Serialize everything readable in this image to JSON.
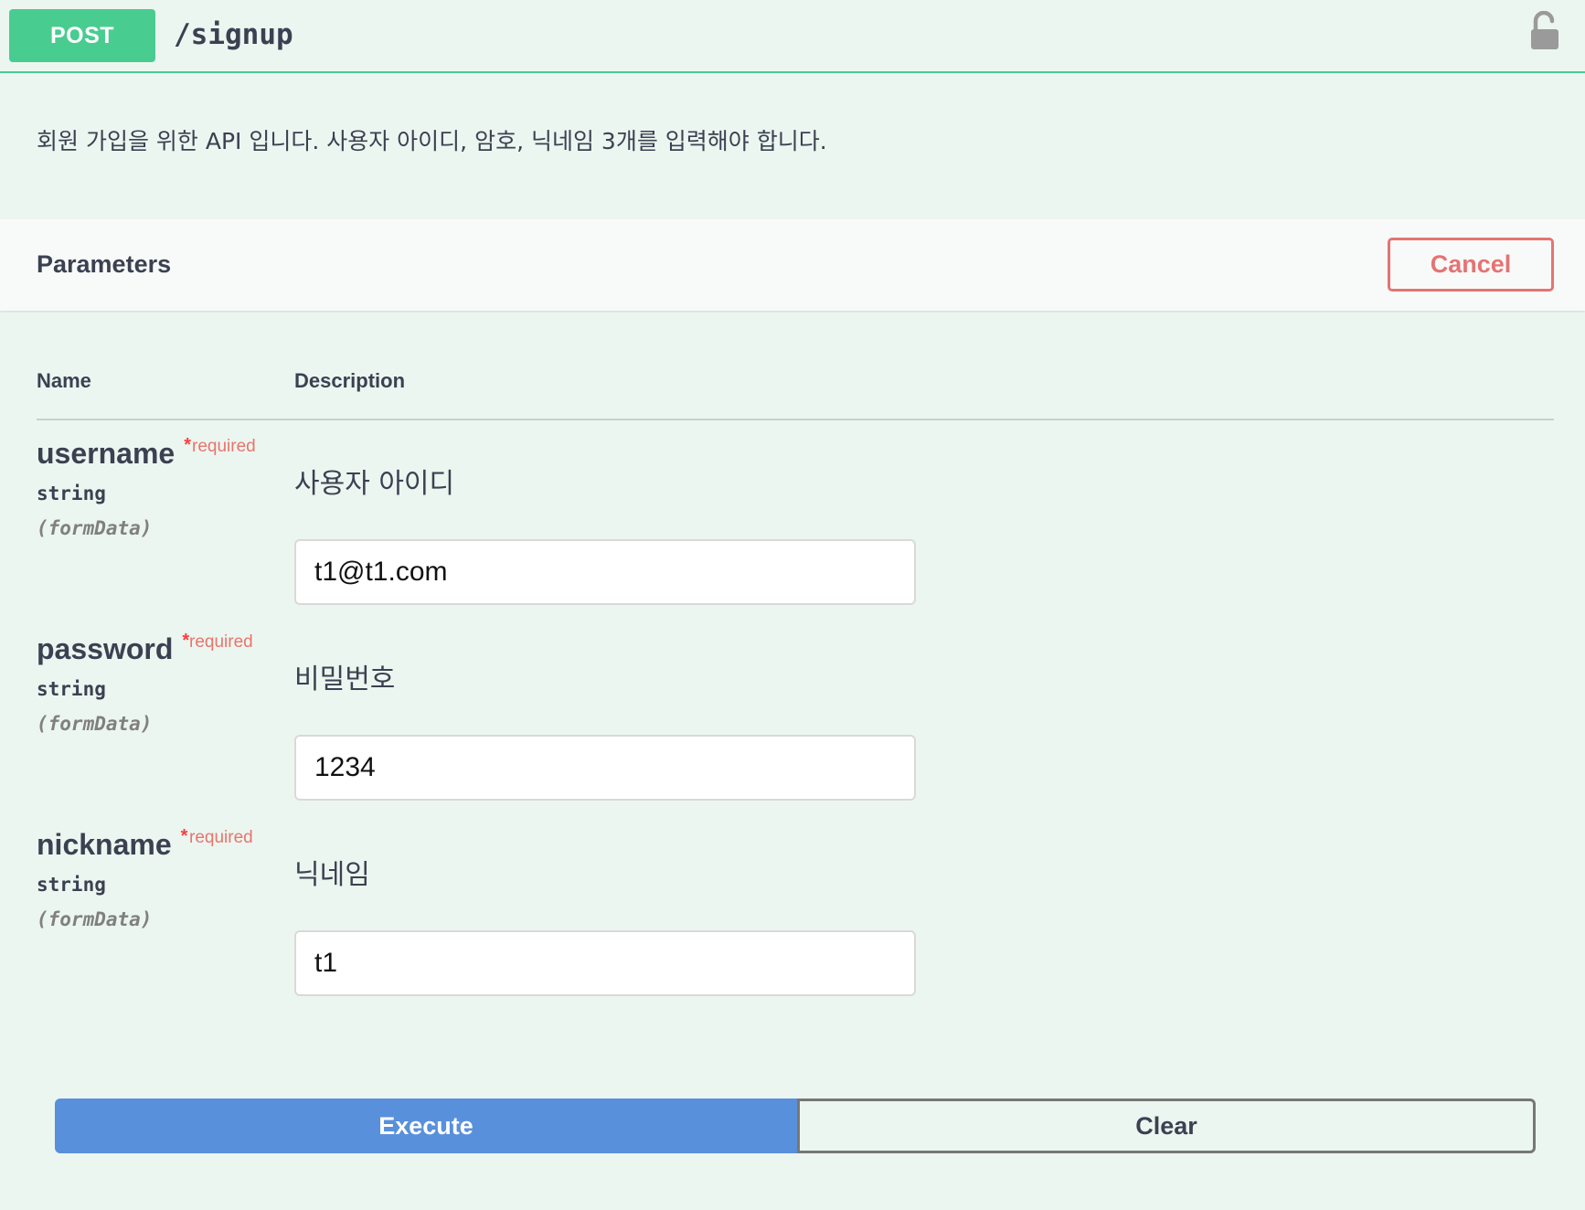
{
  "operation": {
    "method": "POST",
    "path": "/signup",
    "lock_icon": "unlocked-padlock",
    "description": "회원 가입을 위한 API 입니다. 사용자 아이디, 암호, 닉네임 3개를 입력해야 합니다."
  },
  "parameters": {
    "title": "Parameters",
    "cancel_label": "Cancel",
    "columns": {
      "name": "Name",
      "description": "Description"
    },
    "items": [
      {
        "name": "username",
        "required_mark": "*",
        "required_label": "required",
        "type": "string",
        "in": "(formData)",
        "description": "사용자 아이디",
        "value": "t1@t1.com"
      },
      {
        "name": "password",
        "required_mark": "*",
        "required_label": "required",
        "type": "string",
        "in": "(formData)",
        "description": "비밀번호",
        "value": "1234"
      },
      {
        "name": "nickname",
        "required_mark": "*",
        "required_label": "required",
        "type": "string",
        "in": "(formData)",
        "description": "닉네임",
        "value": "t1"
      }
    ]
  },
  "actions": {
    "execute_label": "Execute",
    "clear_label": "Clear"
  },
  "colors": {
    "post": "#49cc90",
    "cancel": "#e57373",
    "execute": "#5890dc",
    "required": "#f93e3e",
    "background": "#ecf6f0"
  }
}
